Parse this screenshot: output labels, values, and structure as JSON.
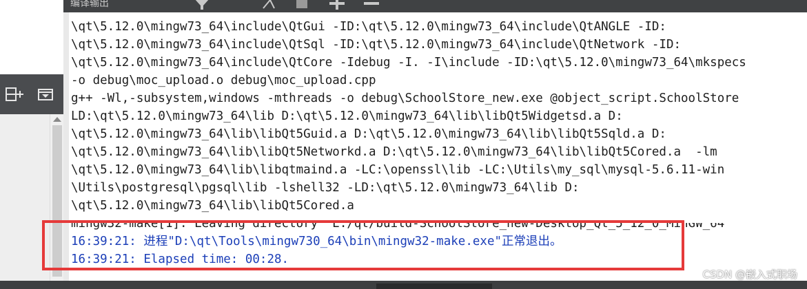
{
  "panel": {
    "title": "编译输出"
  },
  "toolbar": {
    "left_icons": [
      "split-add-icon",
      "minimize-panel-icon"
    ],
    "top_icons": [
      "filter-icon",
      "arrow-icon",
      "stop-icon",
      "plus-icon",
      "minus-icon"
    ]
  },
  "console": {
    "lines": [
      "\\qt\\5.12.0\\mingw73_64\\include\\QtGui -ID:\\qt\\5.12.0\\mingw73_64\\include\\QtANGLE -ID:",
      "\\qt\\5.12.0\\mingw73_64\\include\\QtSql -ID:\\qt\\5.12.0\\mingw73_64\\include\\QtNetwork -ID:",
      "\\qt\\5.12.0\\mingw73_64\\include\\QtCore -Idebug -I. -I\\include -ID:\\qt\\5.12.0\\mingw73_64\\mkspecs",
      "-o debug\\moc_upload.o debug\\moc_upload.cpp",
      "g++ -Wl,-subsystem,windows -mthreads -o debug\\SchoolStore_new.exe @object_script.SchoolStore",
      "LD:\\qt\\5.12.0\\mingw73_64\\lib D:\\qt\\5.12.0\\mingw73_64\\lib\\libQt5Widgetsd.a D:",
      "\\qt\\5.12.0\\mingw73_64\\lib\\libQt5Guid.a D:\\qt\\5.12.0\\mingw73_64\\lib\\libQt5Sqld.a D:",
      "\\qt\\5.12.0\\mingw73_64\\lib\\libQt5Networkd.a D:\\qt\\5.12.0\\mingw73_64\\lib\\libQt5Cored.a  -lm",
      "\\qt\\5.12.0\\mingw73_64\\lib\\libqtmaind.a -LC:\\openssl\\lib -LC:\\Utils\\my_sql\\mysql-5.6.11-win",
      "\\Utils\\postgresql\\pgsql\\lib -lshell32 -LD:\\qt\\5.12.0\\mingw73_64\\lib D:",
      "\\qt\\5.12.0\\mingw73_64\\lib\\libQt5Cored.a",
      "mingw32-make[1]: Leaving directory 'E:/qt/build-SchoolStore_new-Desktop_Qt_5_12_0_MinGW_64"
    ],
    "messages": [
      "16:39:21: 进程\"D:\\qt\\Tools\\mingw730_64\\bin\\mingw32-make.exe\"正常退出。",
      "16:39:21: Elapsed time: 00:28."
    ]
  },
  "watermark": "CSDN @嵌入式职场",
  "colors": {
    "output_text": "#1e1e1e",
    "message_text": "#1c3fb8",
    "highlight_border": "#e53a3a",
    "toolbar_bg": "#4a4c4f"
  }
}
